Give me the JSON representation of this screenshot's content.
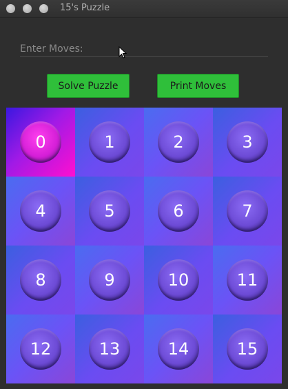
{
  "window": {
    "title": "15's Puzzle"
  },
  "moves_input": {
    "placeholder": "Enter Moves:"
  },
  "buttons": {
    "solve_label": "Solve Puzzle",
    "print_label": "Print Moves"
  },
  "board": {
    "tiles": [
      "0",
      "1",
      "2",
      "3",
      "4",
      "5",
      "6",
      "7",
      "8",
      "9",
      "10",
      "11",
      "12",
      "13",
      "14",
      "15"
    ]
  },
  "colors": {
    "button_green": "#2fbf3a",
    "tile_blue": "#6a4cf2",
    "tile_zero_magenta": "#ff0fd0"
  }
}
